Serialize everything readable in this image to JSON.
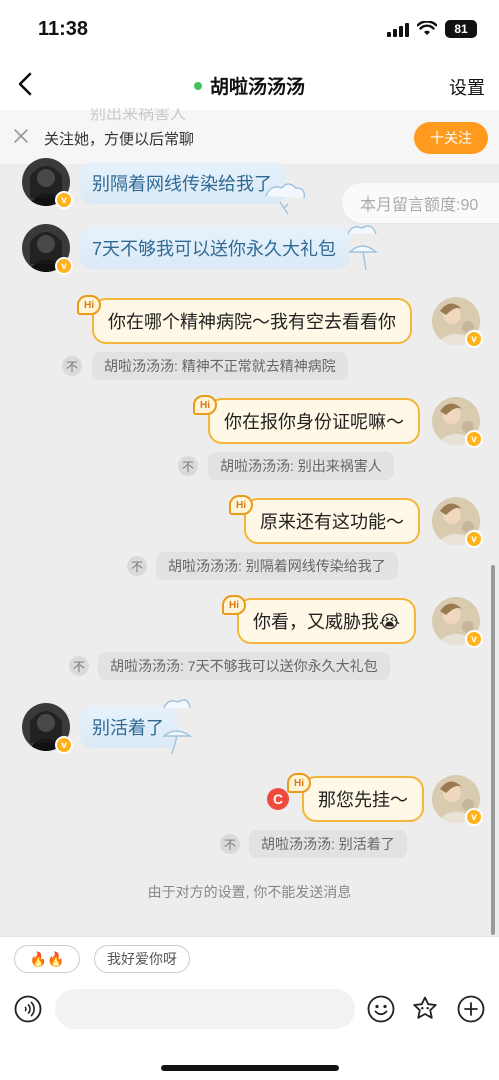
{
  "status_bar": {
    "time": "11:38",
    "battery": "81"
  },
  "nav": {
    "title": "胡啦汤汤汤",
    "settings_label": "设置"
  },
  "follow_banner": {
    "ghost_text": "别出来祸害人",
    "text": "关注她，方便以后常聊",
    "button_label": "十关注"
  },
  "quota_pill": "本月留言额度:90",
  "messages": {
    "in1": "别隔着网线传染给我了",
    "in2": "7天不够我可以送你永久大礼包",
    "out1": "你在哪个精神病院～我有空去看看你",
    "quote1": "胡啦汤汤汤: 精神不正常就去精神病院",
    "out2": "你在报你身份证呢嘛～",
    "quote2": "胡啦汤汤汤: 别出来祸害人",
    "out3": "原来还有这功能～",
    "quote3": "胡啦汤汤汤: 别隔着网线传染给我了",
    "out4": "你看，又威胁我😭",
    "quote4": "胡啦汤汤汤: 7天不够我可以送你永久大礼包",
    "in3": "别活着了",
    "out5": "那您先挂～",
    "quote5": "胡啦汤汤汤: 别活着了"
  },
  "labels": {
    "hi": "Hi",
    "quote_icon": "不",
    "vip_badge": "v",
    "retry_icon": "C"
  },
  "system_note": "由于对方的设置, 你不能发送消息",
  "quick_replies": [
    "🔥🔥",
    "我好爱你呀"
  ],
  "input": {
    "placeholder": ""
  },
  "colors": {
    "accent": "#ff9a1f",
    "online": "#3dc55a",
    "in_bubble_text": "#2f6a94",
    "out_border": "#f3b63a"
  },
  "icons": [
    "back-icon",
    "close-icon",
    "voice-icon",
    "emoji-icon",
    "sticker-icon",
    "plus-icon",
    "umbrella-cloud-icon"
  ]
}
